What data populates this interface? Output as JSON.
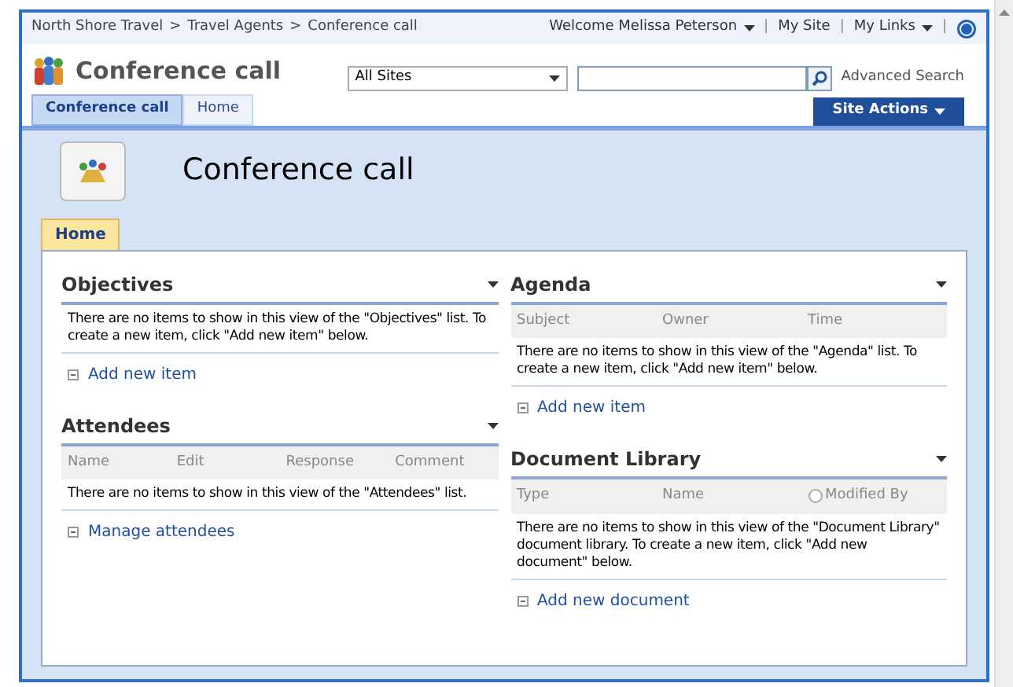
{
  "breadcrumb": [
    "North Shore Travel",
    "Travel Agents",
    "Conference call"
  ],
  "breadcrumb_separator": ">",
  "link_separator": "|",
  "top_links": [
    {
      "label": "Welcome Melissa Peterson",
      "menu": true
    },
    {
      "label": "My Site",
      "menu": false
    },
    {
      "label": "My Links",
      "menu": true
    }
  ],
  "site_title": "Conference call",
  "search": {
    "scope": "All Sites",
    "advanced": "Advanced Search"
  },
  "tabs": [
    {
      "label": "Conference call",
      "selected": true
    },
    {
      "label": "Home",
      "selected": false
    }
  ],
  "site_actions": "Site Actions",
  "page_title": "Conference call",
  "page_tabs": [
    {
      "label": "Home",
      "selected": true
    }
  ],
  "columns": [
    [
      {
        "title": "Objectives",
        "message": "There are no items to show in this view of the \"Objectives\" list. To create a new item, click \"Add new item\" below.",
        "link": "Add new item"
      },
      {
        "title": "Attendees",
        "headers": [
          {
            "label": "Name",
            "indicator": false
          },
          {
            "label": "Edit",
            "indicator": false
          },
          {
            "label": "Response",
            "indicator": false
          },
          {
            "label": "Comment",
            "indicator": false
          }
        ],
        "message": "There are no items to show in this view of the \"Attendees\" list.",
        "link": "Manage attendees"
      }
    ],
    [
      {
        "title": "Agenda",
        "headers": [
          {
            "label": "Subject",
            "indicator": false
          },
          {
            "label": "Owner",
            "indicator": false
          },
          {
            "label": "Time",
            "indicator": false
          }
        ],
        "message": "There are no items to show in this view of the \"Agenda\" list. To create a new item, click \"Add new item\" below.",
        "link": "Add new item"
      },
      {
        "title": "Document Library",
        "headers": [
          {
            "label": "Type",
            "indicator": false
          },
          {
            "label": "Name",
            "indicator": false
          },
          {
            "label": "Modified By",
            "indicator": true
          }
        ],
        "message": "There are no items to show in this view of the \"Document Library\" document library. To create a new item, click \"Add new document\" below.",
        "link": "Add new document"
      }
    ]
  ]
}
